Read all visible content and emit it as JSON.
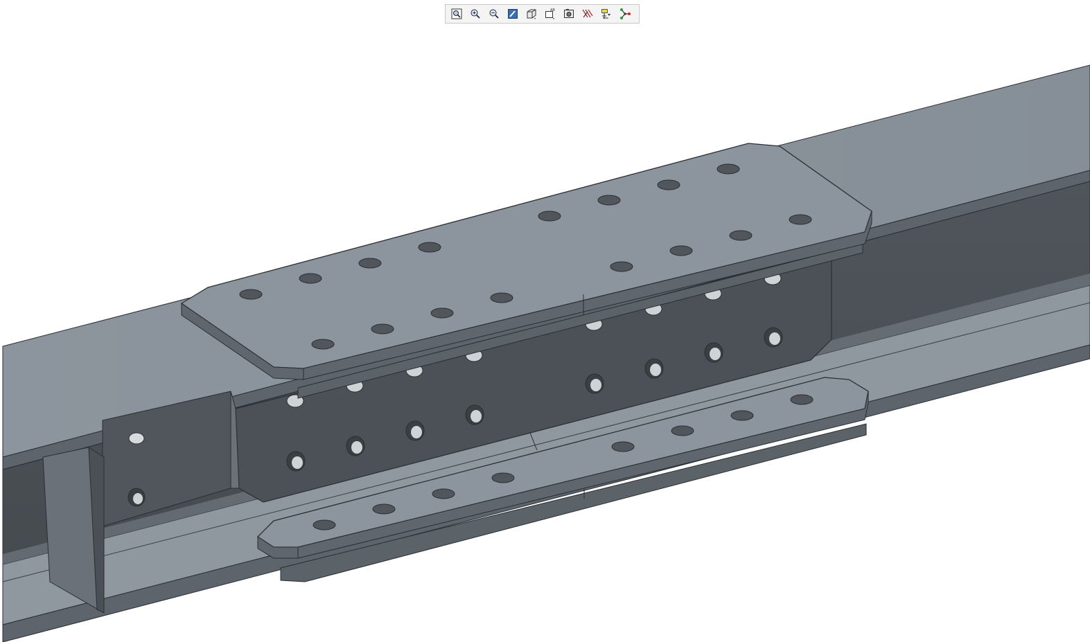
{
  "app": {
    "view": "3d-model-viewport"
  },
  "toolbar": {
    "buttons": [
      {
        "icon": "zoom-fit-icon"
      },
      {
        "icon": "zoom-in-icon"
      },
      {
        "icon": "zoom-out-icon"
      },
      {
        "icon": "repaint-icon"
      },
      {
        "icon": "display-style-icon"
      },
      {
        "icon": "saved-views-icon"
      },
      {
        "icon": "view-manager-icon"
      },
      {
        "icon": "annotation-display-icon"
      },
      {
        "icon": "datum-display-icon"
      },
      {
        "icon": "spin-center-icon"
      }
    ]
  },
  "colors": {
    "background": "#ffffff",
    "steel_light": "#8d969e",
    "steel_mid": "#6b737a",
    "steel_dark": "#4b5056",
    "steel_edge": "#2a2e32",
    "hole": "#3a3f44"
  }
}
